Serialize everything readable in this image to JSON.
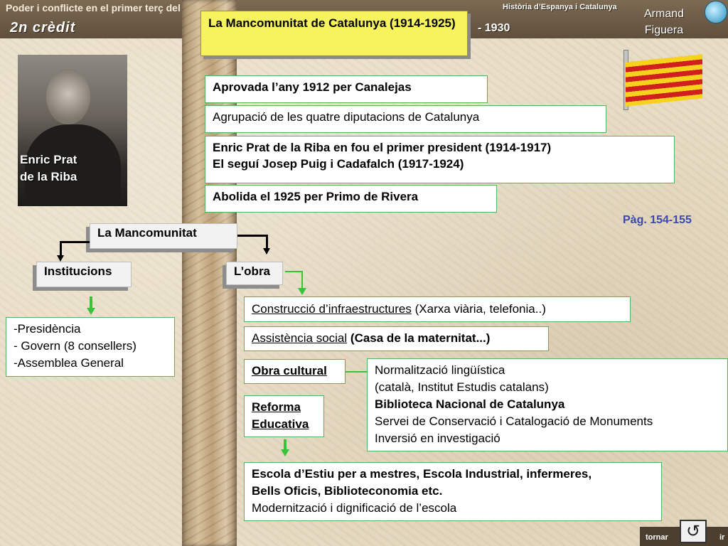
{
  "header": {
    "course_title": "Poder i conflicte en el primer terç del segle XX",
    "credit": "2n crèdit",
    "subject": "Història d’Espanya i Catalunya",
    "year_span": "- 1930",
    "author_line1": "Armand",
    "author_line2": "Figuera"
  },
  "photo": {
    "caption_line1": "Enric Prat",
    "caption_line2": "de la Riba"
  },
  "title_box": {
    "text": "La Mancomunitat de Catalunya (1914-1925)"
  },
  "facts": [
    "Aprovada l’any 1912 per Canalejas",
    "Agrupació de les quatre diputacions de Catalunya",
    "Abolida el 1925 per Primo de Rivera"
  ],
  "presidents": {
    "line1": "Enric Prat de la Riba en fou el primer president (1914-1917)",
    "line2": "El seguí Josep Puig i Cadafalch (1917-1924)"
  },
  "page_ref": "Pàg. 154-155",
  "tree": {
    "root": "La Mancomunitat",
    "left": "Institucions",
    "right": "L’obra"
  },
  "institutions": [
    "-Presidència",
    "- Govern (8 consellers)",
    "-Assemblea General"
  ],
  "works": {
    "infra_label": "Construcció d’infraestructures",
    "infra_detail": "(Xarxa viària, telefonia..)",
    "social_label": "Assistència social",
    "social_detail": "(Casa de la maternitat...)",
    "culture_label": "Obra cultural",
    "culture_items": [
      "Normalització lingüística",
      "(català, Institut Estudis catalans)",
      "Biblioteca Nacional de Catalunya",
      "Servei de Conservació i Catalogació de Monuments",
      "Inversió en investigació"
    ],
    "reform_line1": "Reforma",
    "reform_line2": "Educativa",
    "schools_line1": "Escola d’Estiu per a mestres, Escola Industrial, infermeres,",
    "schools_line2": "Bells Oficis, Biblioteconomia etc.",
    "schools_line3": "Modernització i dignificació de l’escola"
  },
  "nav": {
    "back_label": "tornar",
    "exit_label": "ir",
    "return_icon": "return-arrow-icon"
  },
  "colors": {
    "title_box_bg": "#f7f35e",
    "box_border": "#57b45a",
    "page_ref": "#3b48b0",
    "arrow_green": "#3ac23a"
  }
}
